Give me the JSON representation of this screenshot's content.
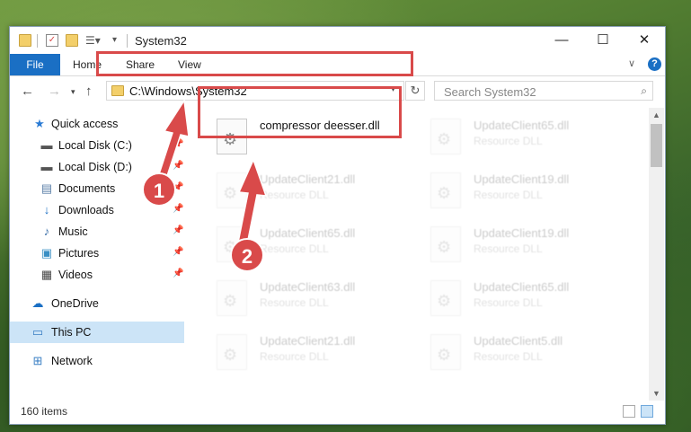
{
  "window": {
    "title": "System32",
    "controls": {
      "minimize": "—",
      "maximize": "☐",
      "close": "✕"
    }
  },
  "ribbon": {
    "tabs": [
      "File",
      "Home",
      "Share",
      "View"
    ],
    "help": "?"
  },
  "address": {
    "path": "C:\\Windows\\System32"
  },
  "search": {
    "placeholder": "Search System32"
  },
  "nav": {
    "items": [
      {
        "label": "Quick access",
        "icon": "star-icon",
        "pinned": false
      },
      {
        "label": "Local Disk (C:)",
        "icon": "drive-icon",
        "pinned": true
      },
      {
        "label": "Local Disk (D:)",
        "icon": "drive-icon",
        "pinned": true
      },
      {
        "label": "Documents",
        "icon": "documents-icon",
        "pinned": true
      },
      {
        "label": "Downloads",
        "icon": "downloads-icon",
        "pinned": true
      },
      {
        "label": "Music",
        "icon": "music-icon",
        "pinned": true
      },
      {
        "label": "Pictures",
        "icon": "pictures-icon",
        "pinned": true
      },
      {
        "label": "Videos",
        "icon": "videos-icon",
        "pinned": true
      },
      {
        "label": "OneDrive",
        "icon": "onedrive-icon",
        "pinned": false
      },
      {
        "label": "This PC",
        "icon": "this-pc-icon",
        "pinned": false
      },
      {
        "label": "Network",
        "icon": "network-icon",
        "pinned": false
      }
    ]
  },
  "files": {
    "highlighted": {
      "name": "compressor deesser.dll",
      "description": ""
    },
    "others": [
      {
        "name": "UpdateClient65.dll",
        "description": "Resource DLL"
      },
      {
        "name": "UpdateClient21.dll",
        "description": "Resource DLL"
      },
      {
        "name": "UpdateClient19.dll",
        "description": "Resource DLL"
      },
      {
        "name": "UpdateClient65.dll",
        "description": "Resource DLL"
      },
      {
        "name": "UpdateClient19.dll",
        "description": "Resource DLL"
      },
      {
        "name": "UpdateClient63.dll",
        "description": "Resource DLL"
      },
      {
        "name": "UpdateClient65.dll",
        "description": "Resource DLL"
      },
      {
        "name": "UpdateClient21.dll",
        "description": "Resource DLL"
      },
      {
        "name": "UpdateClient5.dll",
        "description": "Resource DLL"
      }
    ]
  },
  "status": {
    "item_count": "160 items"
  },
  "annotations": {
    "step1": "1",
    "step2": "2",
    "color": "#d94a4a"
  },
  "colors": {
    "accent": "#1a6fc4",
    "selected": "#cce4f7"
  }
}
